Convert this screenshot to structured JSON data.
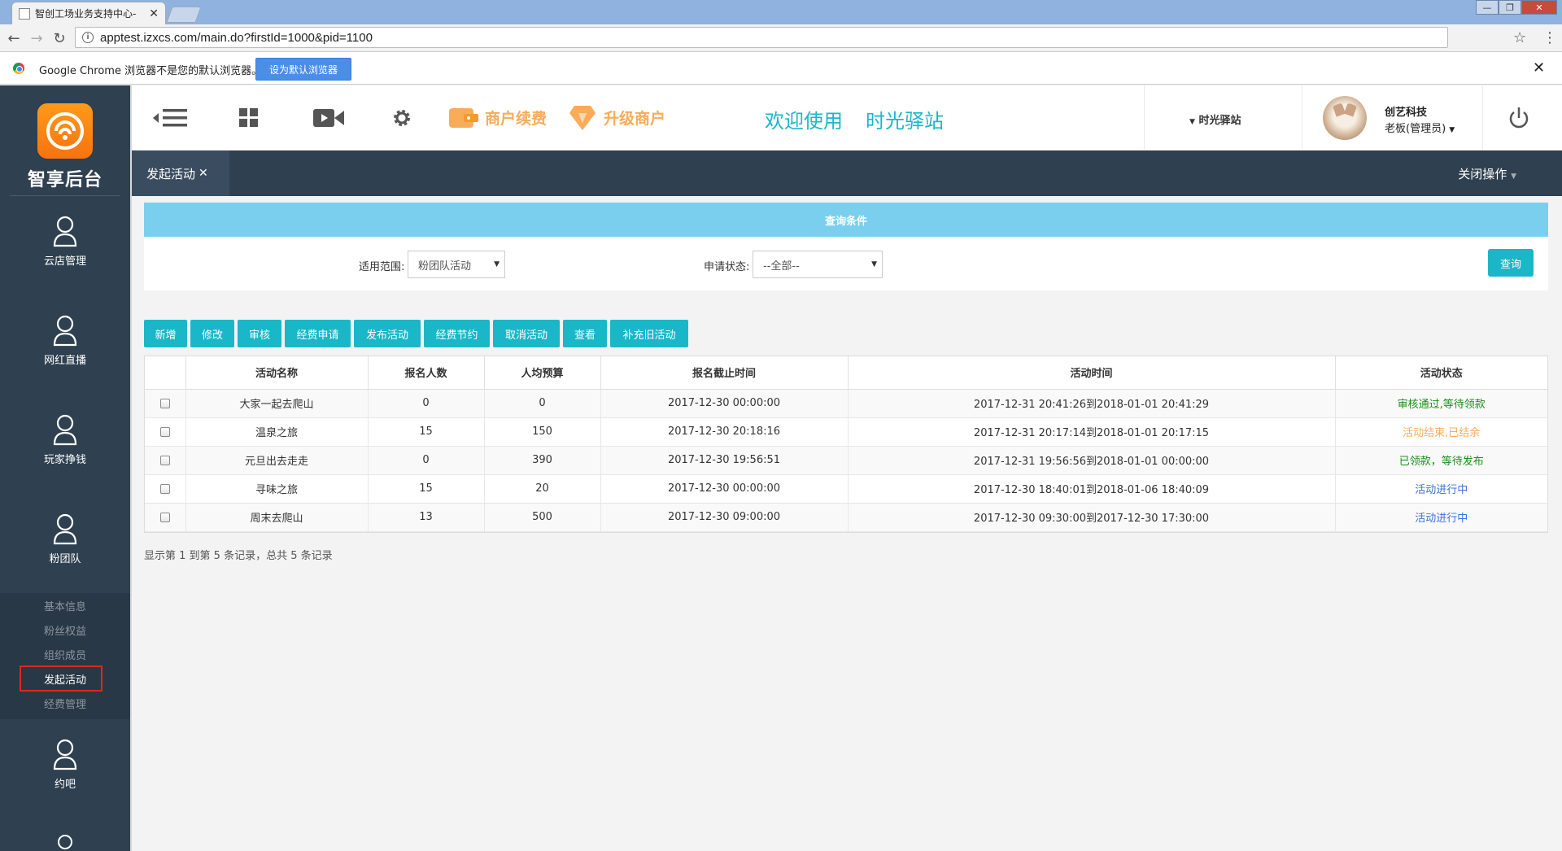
{
  "browser": {
    "tab_title": "智创工场业务支持中心-",
    "url": "apptest.izxcs.com/main.do?firstId=1000&pid=1100",
    "infobar_text": "Google Chrome 浏览器不是您的默认浏览器。",
    "infobar_button": "设为默认浏览器"
  },
  "sidebar": {
    "logo_text": "智享后台",
    "items": [
      {
        "label": "云店管理"
      },
      {
        "label": "网红直播"
      },
      {
        "label": "玩家挣钱"
      },
      {
        "label": "粉团队"
      },
      {
        "label": "约吧"
      }
    ],
    "subitems": [
      {
        "label": "基本信息"
      },
      {
        "label": "粉丝权益"
      },
      {
        "label": "组织成员"
      },
      {
        "label": "发起活动"
      },
      {
        "label": "经费管理"
      }
    ]
  },
  "topnav": {
    "renew_label": "商户续费",
    "upgrade_label": "升级商户",
    "welcome": "欢迎使用",
    "brand": "时光驿站",
    "store": "时光驿站",
    "user_name": "创艺科技",
    "user_role": "老板(管理员)"
  },
  "tabs": {
    "current": "发起活动",
    "close_ops": "关闭操作"
  },
  "query": {
    "title": "查询条件",
    "scope_label": "适用范围:",
    "scope_value": "粉团队活动",
    "status_label": "申请状态:",
    "status_value": "--全部--",
    "button": "查询"
  },
  "toolbar": [
    "新增",
    "修改",
    "审核",
    "经费申请",
    "发布活动",
    "经费节约",
    "取消活动",
    "查看",
    "补充旧活动"
  ],
  "table": {
    "headers": [
      "活动名称",
      "报名人数",
      "人均预算",
      "报名截止时间",
      "活动时间",
      "活动状态"
    ],
    "rows": [
      {
        "name": "大家一起去爬山",
        "count": "0",
        "budget": "0",
        "deadline": "2017-12-30 00:00:00",
        "time": "2017-12-31 20:41:26到2018-01-01 20:41:29",
        "status": "审核通过,等待领款"
      },
      {
        "name": "温泉之旅",
        "count": "15",
        "budget": "150",
        "deadline": "2017-12-30 20:18:16",
        "time": "2017-12-31 20:17:14到2018-01-01 20:17:15",
        "status": "活动结束,已结余"
      },
      {
        "name": "元旦出去走走",
        "count": "0",
        "budget": "390",
        "deadline": "2017-12-30 19:56:51",
        "time": "2017-12-31 19:56:56到2018-01-01 00:00:00",
        "status": "已领款，等待发布"
      },
      {
        "name": "寻味之旅",
        "count": "15",
        "budget": "20",
        "deadline": "2017-12-30 00:00:00",
        "time": "2017-12-30 18:40:01到2018-01-06 18:40:09",
        "status": "活动进行中"
      },
      {
        "name": "周末去爬山",
        "count": "13",
        "budget": "500",
        "deadline": "2017-12-30 09:00:00",
        "time": "2017-12-30 09:30:00到2017-12-30 17:30:00",
        "status": "活动进行中"
      }
    ],
    "footer": "显示第 1 到第 5 条记录，总共 5 条记录"
  },
  "colors": {
    "accent": "#1ab7c8",
    "sidebar": "#2f4050",
    "query_header": "#7acfef",
    "orange": "#f8ac59"
  }
}
